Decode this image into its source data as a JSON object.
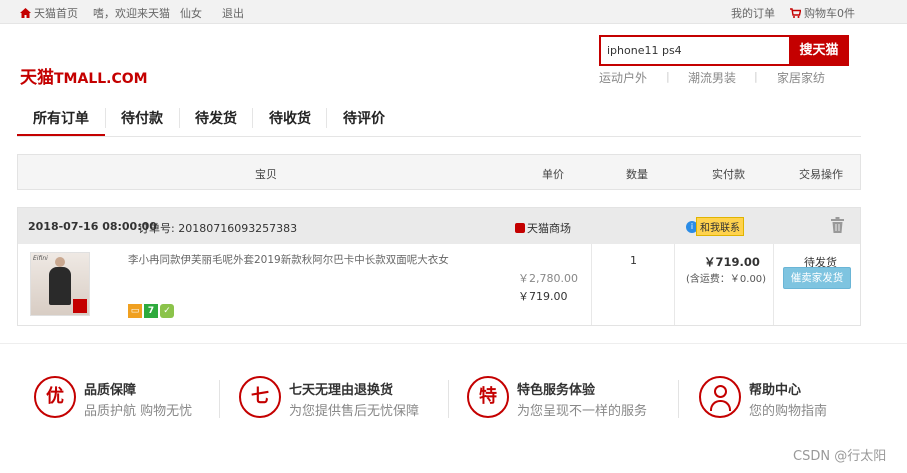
{
  "topbar": {
    "home": "天猫首页",
    "greeting": "嗜，欢迎来天猫",
    "user": "仙女",
    "logout": "退出",
    "my_orders": "我的订单",
    "cart": "购物车0件"
  },
  "header": {
    "logo_cn": "天猫",
    "logo_en": "TMALL.COM",
    "search_value": "iphone11  ps4",
    "search_button": "搜天猫",
    "hotwords": [
      "运动户外",
      "潮流男装",
      "家居家纺"
    ],
    "hot_separator": "|"
  },
  "tabs": [
    "所有订单",
    "待付款",
    "待发货",
    "待收货",
    "待评价"
  ],
  "table_header": {
    "item": "宝贝",
    "unit_price": "单价",
    "quantity": "数量",
    "paid": "实付款",
    "action": "交易操作"
  },
  "order": {
    "date": "2018-07-16 08:00:00",
    "order_no": "订单号: 20180716093257383",
    "shop": "天猫商场",
    "contact": "和我联系",
    "contact_dot": "i",
    "product_title": "李小冉同款伊芙丽毛呢外套2019新款秋阿尔巴卡中长款双面呢大衣女",
    "thumb_label": "Eifini",
    "badge_seven": "7",
    "price_original": "￥2,780.00",
    "price_now": "￥719.00",
    "quantity": "1",
    "paid_amount": "￥719.00",
    "freight": "(含运费：￥0.00)",
    "status": "待发货",
    "remind_button": "催卖家发货"
  },
  "services": [
    {
      "icon": "优",
      "title": "品质保障",
      "subtitle": "品质护航 购物无忧"
    },
    {
      "icon": "七",
      "title": "七天无理由退换货",
      "subtitle": "为您提供售后无忧保障"
    },
    {
      "icon": "特",
      "title": "特色服务体验",
      "subtitle": "为您呈现不一样的服务"
    },
    {
      "icon": "help-person-icon",
      "title": "帮助中心",
      "subtitle": "您的购物指南"
    }
  ],
  "watermark": "CSDN @行太阳",
  "colors": {
    "brand": "#c40000",
    "remind_button": "#7ec4e0",
    "contact_badge": "#ffd24d"
  }
}
